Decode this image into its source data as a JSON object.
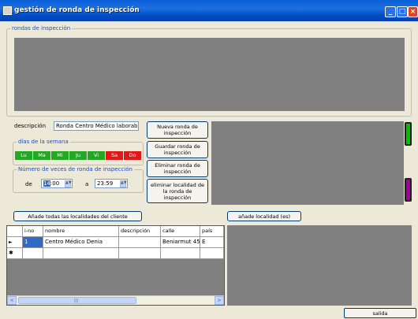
{
  "window": {
    "title": "gestión de ronda de inspección",
    "min_glyph": "_",
    "max_glyph": "□",
    "close_glyph": "×"
  },
  "rounds_group": {
    "legend": "rondas de inspección"
  },
  "description": {
    "label": "descripción",
    "value": "Ronda Centro Médico laborable"
  },
  "days_group": {
    "legend": "días de la semana",
    "days": [
      {
        "label": "Lu",
        "color": "#22a822"
      },
      {
        "label": "Ma",
        "color": "#22a822"
      },
      {
        "label": "Mi",
        "color": "#22a822"
      },
      {
        "label": "Ju",
        "color": "#22a822"
      },
      {
        "label": "Vi",
        "color": "#22a822"
      },
      {
        "label": "Sa",
        "color": "#e01818"
      },
      {
        "label": "Do",
        "color": "#e01818"
      }
    ]
  },
  "times_group": {
    "legend": "Número de veces de ronda de inspección",
    "from_label": "de",
    "from_hour": "14",
    "from_rest": ":00",
    "to_label": "a",
    "to_value": "23:59",
    "spin_glyph": "▲▼"
  },
  "buttons": {
    "new_round": "Nueva ronda de inspección",
    "save_round": "Guardar ronda de inspección",
    "delete_round": "Eliminar ronda de inspección",
    "delete_location": "eliminar localidad de la ronda de inspección",
    "add_all": "Añade todas las localidades del cliente",
    "add_location": "añade localidad (es)",
    "exit": "salida"
  },
  "grid": {
    "columns": [
      "i-no",
      "nombre",
      "descripción",
      "calle",
      "país"
    ],
    "rows": [
      {
        "marker": "►",
        "cells": [
          "1",
          "Centro Médico Denia",
          "",
          "Beniarmut 45",
          "E"
        ]
      },
      {
        "marker": "✱",
        "cells": [
          "",
          "",
          "",
          "",
          ""
        ]
      }
    ],
    "scroll_left": "<",
    "scroll_right": ">",
    "thumb_grip": "|||"
  },
  "colors": {
    "green_bar": "#00c000",
    "purple_bar": "#a000a0"
  }
}
